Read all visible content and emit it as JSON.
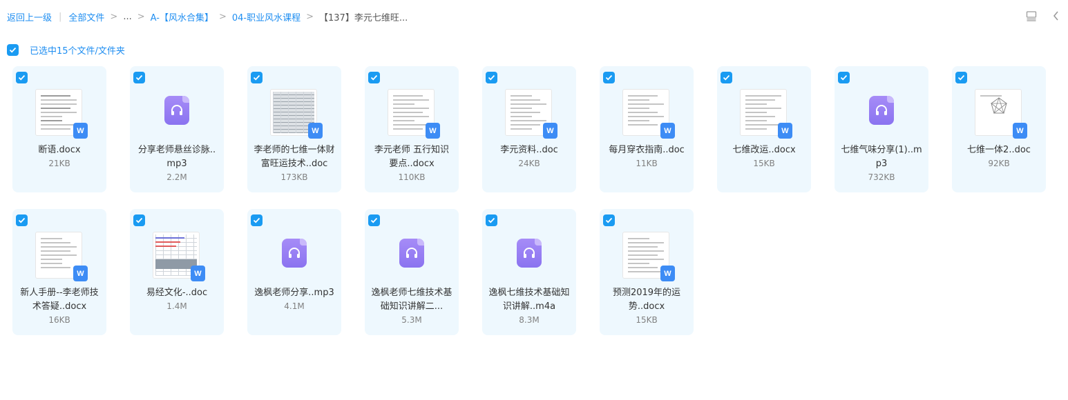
{
  "breadcrumb": {
    "back": "返回上一级",
    "all_files": "全部文件",
    "ellipsis": "...",
    "folder1": "A-【风水合集】",
    "folder2": "04-职业风水课程",
    "current": "【137】李元七维旺..."
  },
  "selection": {
    "text": "已选中15个文件/文件夹"
  },
  "colors": {
    "accent": "#1a9bf2",
    "card_bg": "#eef8fe",
    "word_badge": "#3d8cf5",
    "audio_icon": "#9a80f5"
  },
  "files": [
    {
      "name": "断语.docx",
      "size": "21KB",
      "kind": "word",
      "icon": "word-doc-icon"
    },
    {
      "name": "分享老师悬丝诊脉..mp3",
      "size": "2.2M",
      "kind": "audio",
      "icon": "headphones-icon"
    },
    {
      "name": "李老师的七维一体财富旺运技术..doc",
      "size": "173KB",
      "kind": "word",
      "icon": "word-doc-icon"
    },
    {
      "name": "李元老师 五行知识要点..docx",
      "size": "110KB",
      "kind": "word",
      "icon": "word-doc-icon"
    },
    {
      "name": "李元资料..doc",
      "size": "24KB",
      "kind": "word",
      "icon": "word-doc-icon"
    },
    {
      "name": "每月穿衣指南..doc",
      "size": "11KB",
      "kind": "word",
      "icon": "word-doc-icon"
    },
    {
      "name": "七维改运..docx",
      "size": "15KB",
      "kind": "word",
      "icon": "word-doc-icon"
    },
    {
      "name": "七维气味分享(1)..mp3",
      "size": "732KB",
      "kind": "audio",
      "icon": "headphones-icon"
    },
    {
      "name": "七维一体2..doc",
      "size": "92KB",
      "kind": "word",
      "icon": "word-doc-icon"
    },
    {
      "name": "新人手册--李老师技术答疑..docx",
      "size": "16KB",
      "kind": "word",
      "icon": "word-doc-icon"
    },
    {
      "name": "易经文化-..doc",
      "size": "1.4M",
      "kind": "word",
      "icon": "word-doc-icon"
    },
    {
      "name": "逸枫老师分享..mp3",
      "size": "4.1M",
      "kind": "audio",
      "icon": "headphones-icon"
    },
    {
      "name": "逸枫老师七维技术基础知识讲解二...",
      "size": "5.3M",
      "kind": "audio",
      "icon": "headphones-icon"
    },
    {
      "name": "逸枫七维技术基础知识讲解..m4a",
      "size": "8.3M",
      "kind": "audio",
      "icon": "headphones-icon"
    },
    {
      "name": "预测2019年的运势..docx",
      "size": "15KB",
      "kind": "word",
      "icon": "word-doc-icon"
    }
  ]
}
